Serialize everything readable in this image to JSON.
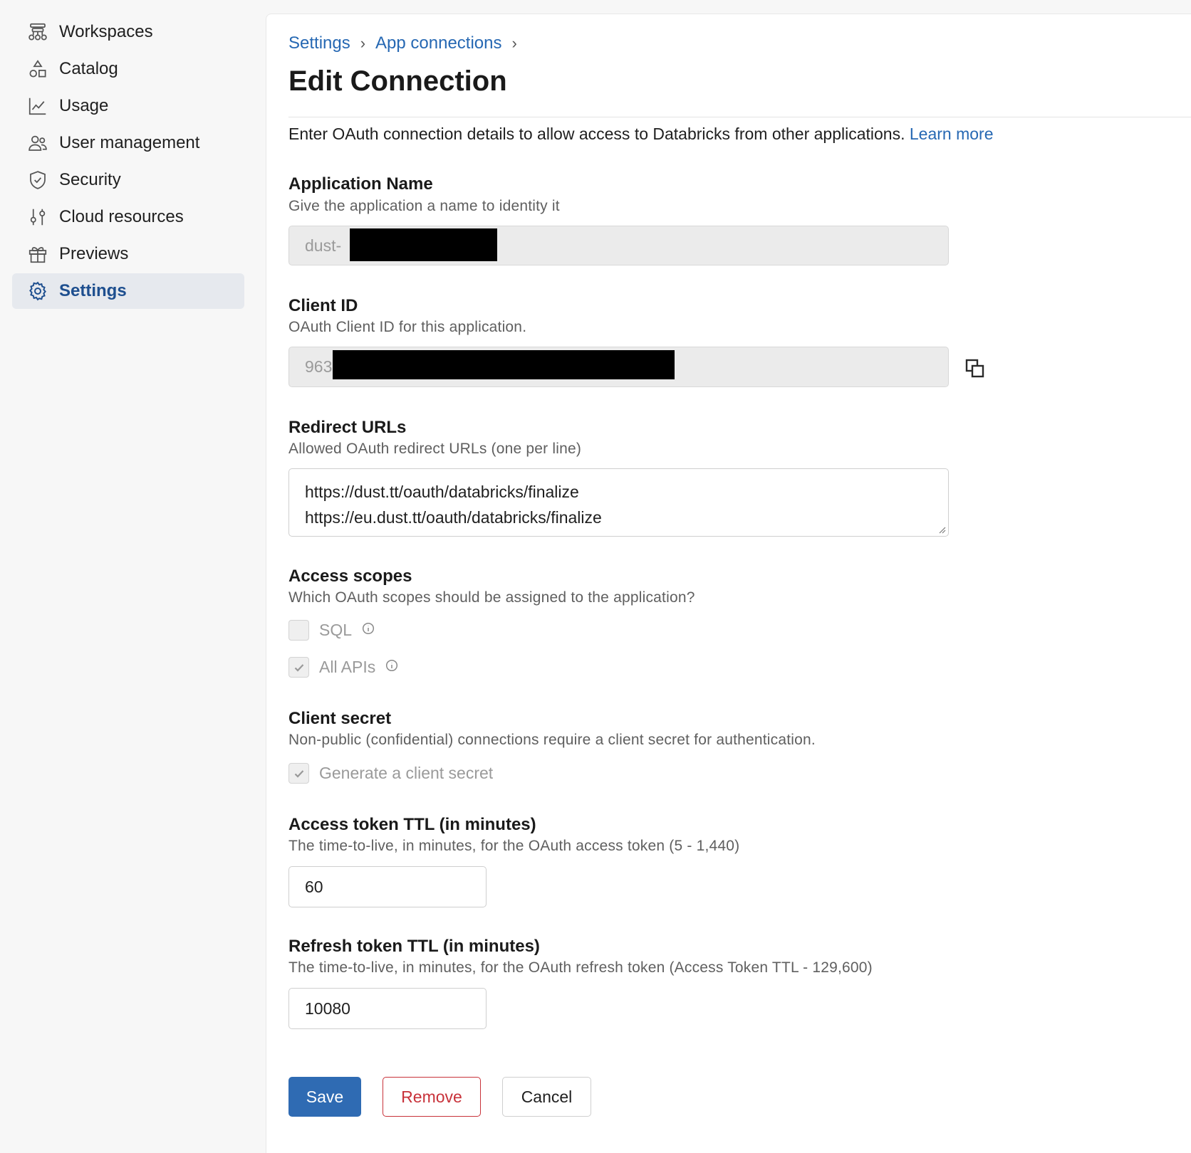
{
  "sidebar": {
    "items": [
      {
        "label": "Workspaces",
        "icon": "workspaces-icon"
      },
      {
        "label": "Catalog",
        "icon": "catalog-icon"
      },
      {
        "label": "Usage",
        "icon": "usage-chart-icon"
      },
      {
        "label": "User management",
        "icon": "users-icon"
      },
      {
        "label": "Security",
        "icon": "shield-icon"
      },
      {
        "label": "Cloud resources",
        "icon": "sliders-icon"
      },
      {
        "label": "Previews",
        "icon": "gift-icon"
      },
      {
        "label": "Settings",
        "icon": "gear-icon",
        "active": true
      }
    ]
  },
  "breadcrumb": {
    "items": [
      "Settings",
      "App connections"
    ],
    "separator": "›"
  },
  "page": {
    "title": "Edit Connection",
    "intro": "Enter OAuth connection details to allow access to Databricks from other applications.",
    "intro_link": "Learn more"
  },
  "form": {
    "app_name": {
      "label": "Application Name",
      "help": "Give the application a name to identity it",
      "value": "dust-"
    },
    "client_id": {
      "label": "Client ID",
      "help": "OAuth Client ID for this application.",
      "value": "963"
    },
    "redirect_urls": {
      "label": "Redirect URLs",
      "help": "Allowed OAuth redirect URLs (one per line)",
      "lines": [
        "https://dust.tt/oauth/databricks/finalize",
        "https://eu.dust.tt/oauth/databricks/finalize"
      ]
    },
    "access_scopes": {
      "label": "Access scopes",
      "help": "Which OAuth scopes should be assigned to the application?",
      "options": [
        {
          "label": "SQL",
          "checked": false
        },
        {
          "label": "All APIs",
          "checked": true
        }
      ]
    },
    "client_secret": {
      "label": "Client secret",
      "help": "Non-public (confidential) connections require a client secret for authentication.",
      "option": {
        "label": "Generate a client secret",
        "checked": true
      }
    },
    "access_ttl": {
      "label": "Access token TTL (in minutes)",
      "help": "The time-to-live, in minutes, for the OAuth access token (5 - 1,440)",
      "value": "60"
    },
    "refresh_ttl": {
      "label": "Refresh token TTL (in minutes)",
      "help": "The time-to-live, in minutes, for the OAuth refresh token (Access Token TTL - 129,600)",
      "value": "10080"
    }
  },
  "actions": {
    "save": "Save",
    "remove": "Remove",
    "cancel": "Cancel"
  },
  "colors": {
    "accent": "#2f6bb3",
    "link": "#2668b3",
    "danger": "#c8323a",
    "active_nav_bg": "#e6e9ee"
  }
}
